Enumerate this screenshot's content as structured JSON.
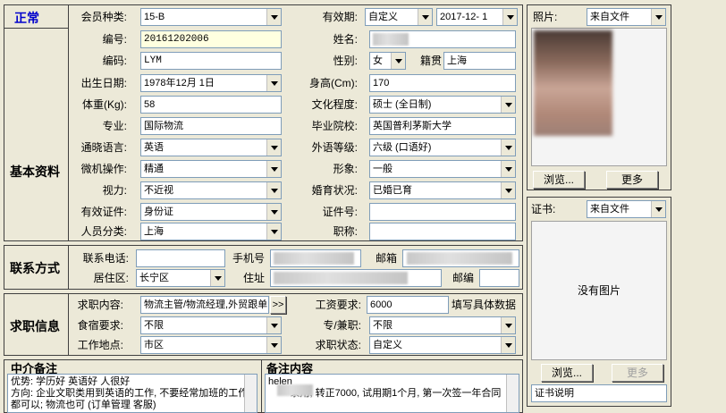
{
  "status": "正常",
  "sections": {
    "basic": "基本资料",
    "contact": "联系方式",
    "job": "求职信息",
    "agency_notes": "中介备注",
    "notes": "备注内容"
  },
  "fields": {
    "member_type": {
      "label": "会员种类:",
      "value": "15-B"
    },
    "validity": {
      "label": "有效期:",
      "mode": "自定义",
      "date": "2017-12- 1"
    },
    "number": {
      "label": "编号:",
      "value": "20161202006"
    },
    "name": {
      "label": "姓名:",
      "value": ""
    },
    "code": {
      "label": "编码:",
      "value": "LYM"
    },
    "gender": {
      "label": "性别:",
      "value": "女"
    },
    "hometown": {
      "label": "籍贯",
      "value": "上海"
    },
    "birth": {
      "label": "出生日期:",
      "value": "1978年12月 1日"
    },
    "height": {
      "label": "身高(Cm):",
      "value": "170"
    },
    "weight": {
      "label": "体重(Kg):",
      "value": "58"
    },
    "education": {
      "label": "文化程度:",
      "value": "硕士 (全日制)"
    },
    "major": {
      "label": "专业:",
      "value": "国际物流"
    },
    "school": {
      "label": "毕业院校:",
      "value": "英国普利茅斯大学"
    },
    "language": {
      "label": "通晓语言:",
      "value": "英语"
    },
    "lang_level": {
      "label": "外语等级:",
      "value": "六级 (口语好)"
    },
    "computer": {
      "label": "微机操作:",
      "value": "精通"
    },
    "image": {
      "label": "形象:",
      "value": "一般"
    },
    "vision": {
      "label": "视力:",
      "value": "不近视"
    },
    "marital": {
      "label": "婚育状况:",
      "value": "已婚已育"
    },
    "id_type": {
      "label": "有效证件:",
      "value": "身份证"
    },
    "id_number": {
      "label": "证件号:",
      "value": ""
    },
    "category": {
      "label": "人员分类:",
      "value": "上海"
    },
    "title": {
      "label": "职称:",
      "value": ""
    },
    "phone": {
      "label": "联系电话:",
      "value": ""
    },
    "mobile": {
      "label": "手机号",
      "value": ""
    },
    "email": {
      "label": "邮箱",
      "value": ""
    },
    "district": {
      "label": "居住区:",
      "value": "长宁区"
    },
    "address": {
      "label": "住址",
      "value": ""
    },
    "postcode": {
      "label": "邮编",
      "value": ""
    },
    "job_content": {
      "label": "求职内容:",
      "value": "物流主管/物流经理,外贸跟单",
      "btn": ">>"
    },
    "salary": {
      "label": "工资要求:",
      "value": "6000",
      "hint": "填写具体数据"
    },
    "food": {
      "label": "食宿要求:",
      "value": "不限"
    },
    "parttime": {
      "label": "专/兼职:",
      "value": "不限"
    },
    "workplace": {
      "label": "工作地点:",
      "value": "市区"
    },
    "job_status": {
      "label": "求职状态:",
      "value": "自定义"
    }
  },
  "agency_notes_text": "优势: 学历好 英语好 人很好\n方向: 企业文职类用到英语的工作, 不要经常加班的工作都可以; 物流也可 (订单管理 客服)",
  "notes_text": "helen\n        录用, 转正7000, 试用期1个月, 第一次签一年合同",
  "photo": {
    "label": "照片:",
    "source": "来自文件",
    "browse": "浏览...",
    "more": "更多"
  },
  "certificate": {
    "label": "证书:",
    "source": "来自文件",
    "empty": "没有图片",
    "browse": "浏览...",
    "more": "更多",
    "desc": "证书说明"
  }
}
